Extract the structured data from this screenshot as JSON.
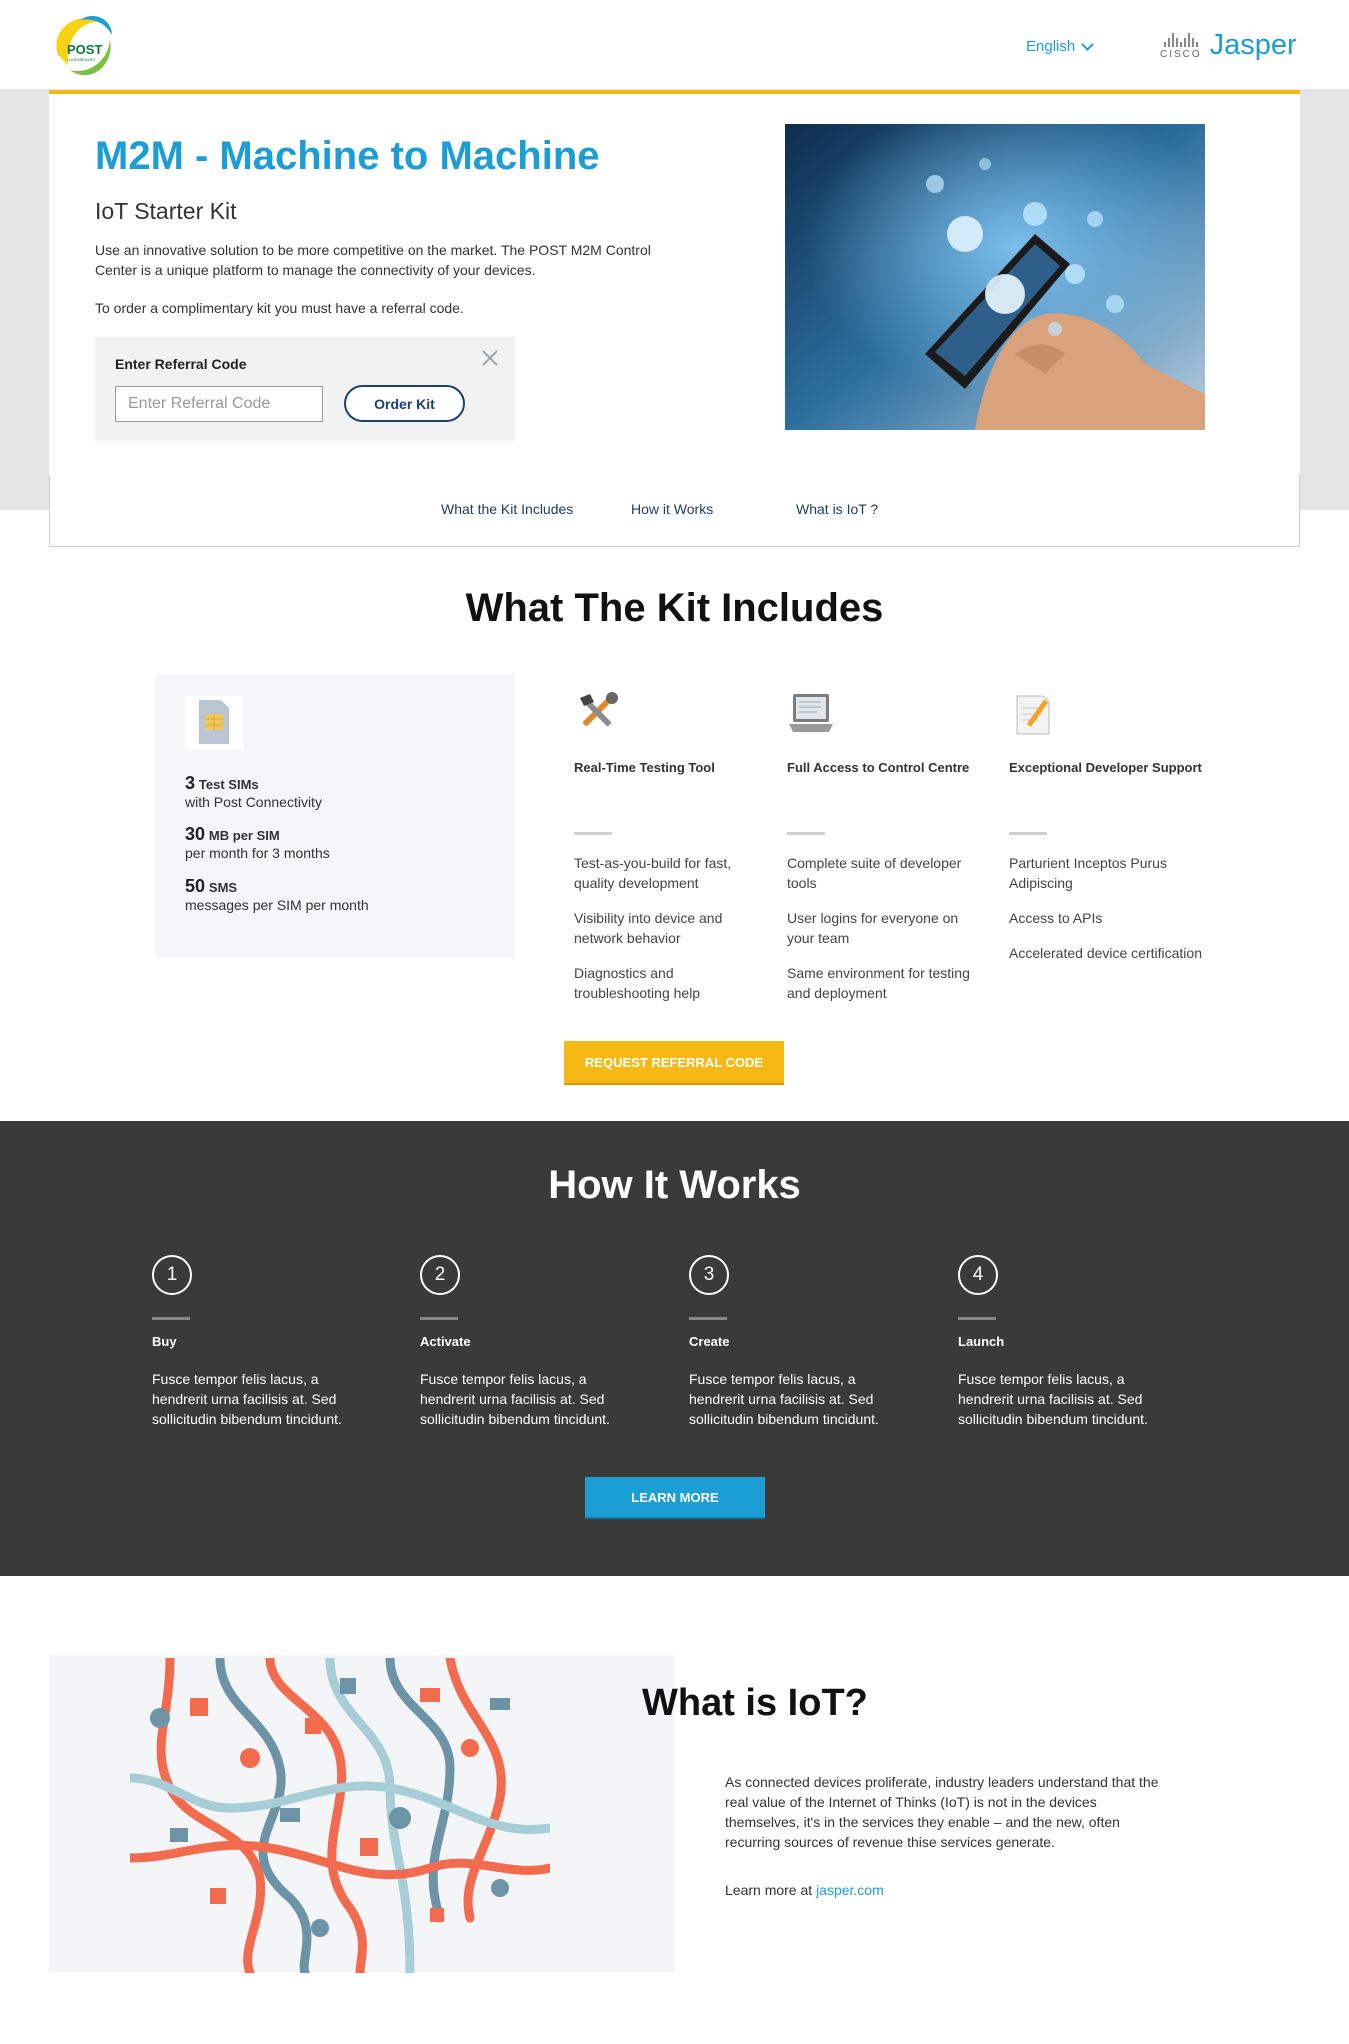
{
  "header": {
    "logo_text": "POST",
    "logo_subtext": "LUXEMBOURG",
    "language": "English",
    "cisco_word": "CISCO",
    "brand": "Jasper"
  },
  "hero": {
    "title": "M2M - Machine to Machine",
    "subtitle": "IoT Starter Kit",
    "description": "Use an innovative solution to be more competitive on the market. The POST M2M Control Center is a unique platform to manage the connectivity of your devices.",
    "referral_note": "To order a complimentary kit you must have a referral code.",
    "referral_label": "Enter Referral Code",
    "referral_placeholder": "Enter Referral Code",
    "order_button": "Order Kit"
  },
  "tabs": [
    "What the Kit Includes",
    "How it Works",
    "What is IoT ?"
  ],
  "kit": {
    "title": "What The Kit Includes",
    "stats": [
      {
        "value": "3",
        "unit": "Test SIMs",
        "desc": "with Post Connectivity"
      },
      {
        "value": "30",
        "unit": "MB per SIM",
        "desc": "per month for 3 months"
      },
      {
        "value": "50",
        "unit": "SMS",
        "desc": "messages per SIM per month"
      }
    ],
    "features": [
      {
        "icon": "tools-icon",
        "title": "Real-Time Testing Tool",
        "items": [
          "Test-as-you-build for fast, quality development",
          "Visibility into device and network behavior",
          "Diagnostics and troubleshooting help"
        ]
      },
      {
        "icon": "laptop-icon",
        "title": "Full Access to Control Centre",
        "items": [
          "Complete suite of developer tools",
          "User logins for everyone on your team",
          "Same environment for testing and deployment"
        ]
      },
      {
        "icon": "notepad-icon",
        "title": "Exceptional Developer Support",
        "items": [
          "Parturient Inceptos Purus Adipiscing",
          "Access to APIs",
          "Accelerated device certification"
        ]
      }
    ],
    "request_button": "REQUEST REFERRAL CODE"
  },
  "how": {
    "title": "How It Works",
    "steps": [
      {
        "num": "1",
        "title": "Buy",
        "text": "Fusce tempor felis lacus, a hendrerit urna facilisis at. Sed sollicitudin bibendum tincidunt."
      },
      {
        "num": "2",
        "title": "Activate",
        "text": "Fusce tempor felis lacus, a hendrerit urna facilisis at. Sed sollicitudin bibendum tincidunt."
      },
      {
        "num": "3",
        "title": "Create",
        "text": "Fusce tempor felis lacus, a hendrerit urna facilisis at. Sed sollicitudin bibendum tincidunt."
      },
      {
        "num": "4",
        "title": "Launch",
        "text": "Fusce tempor felis lacus, a hendrerit urna facilisis at. Sed sollicitudin bibendum tincidunt."
      }
    ],
    "learn_button": "LEARN MORE"
  },
  "iot": {
    "title": "What is IoT?",
    "text": "As connected devices proliferate, industry leaders understand that the real value of the Internet of Thinks (IoT) is not in the devices themselves, it's in the services they enable – and the new, often recurring sources of revenue thise services generate.",
    "learn_prefix": "Learn more at ",
    "link_text": "jasper.com"
  },
  "colors": {
    "accent_blue": "#1a9ed4",
    "accent_yellow": "#f6b814",
    "dark_section": "#3a3a38",
    "navy": "#1d3f6e"
  }
}
